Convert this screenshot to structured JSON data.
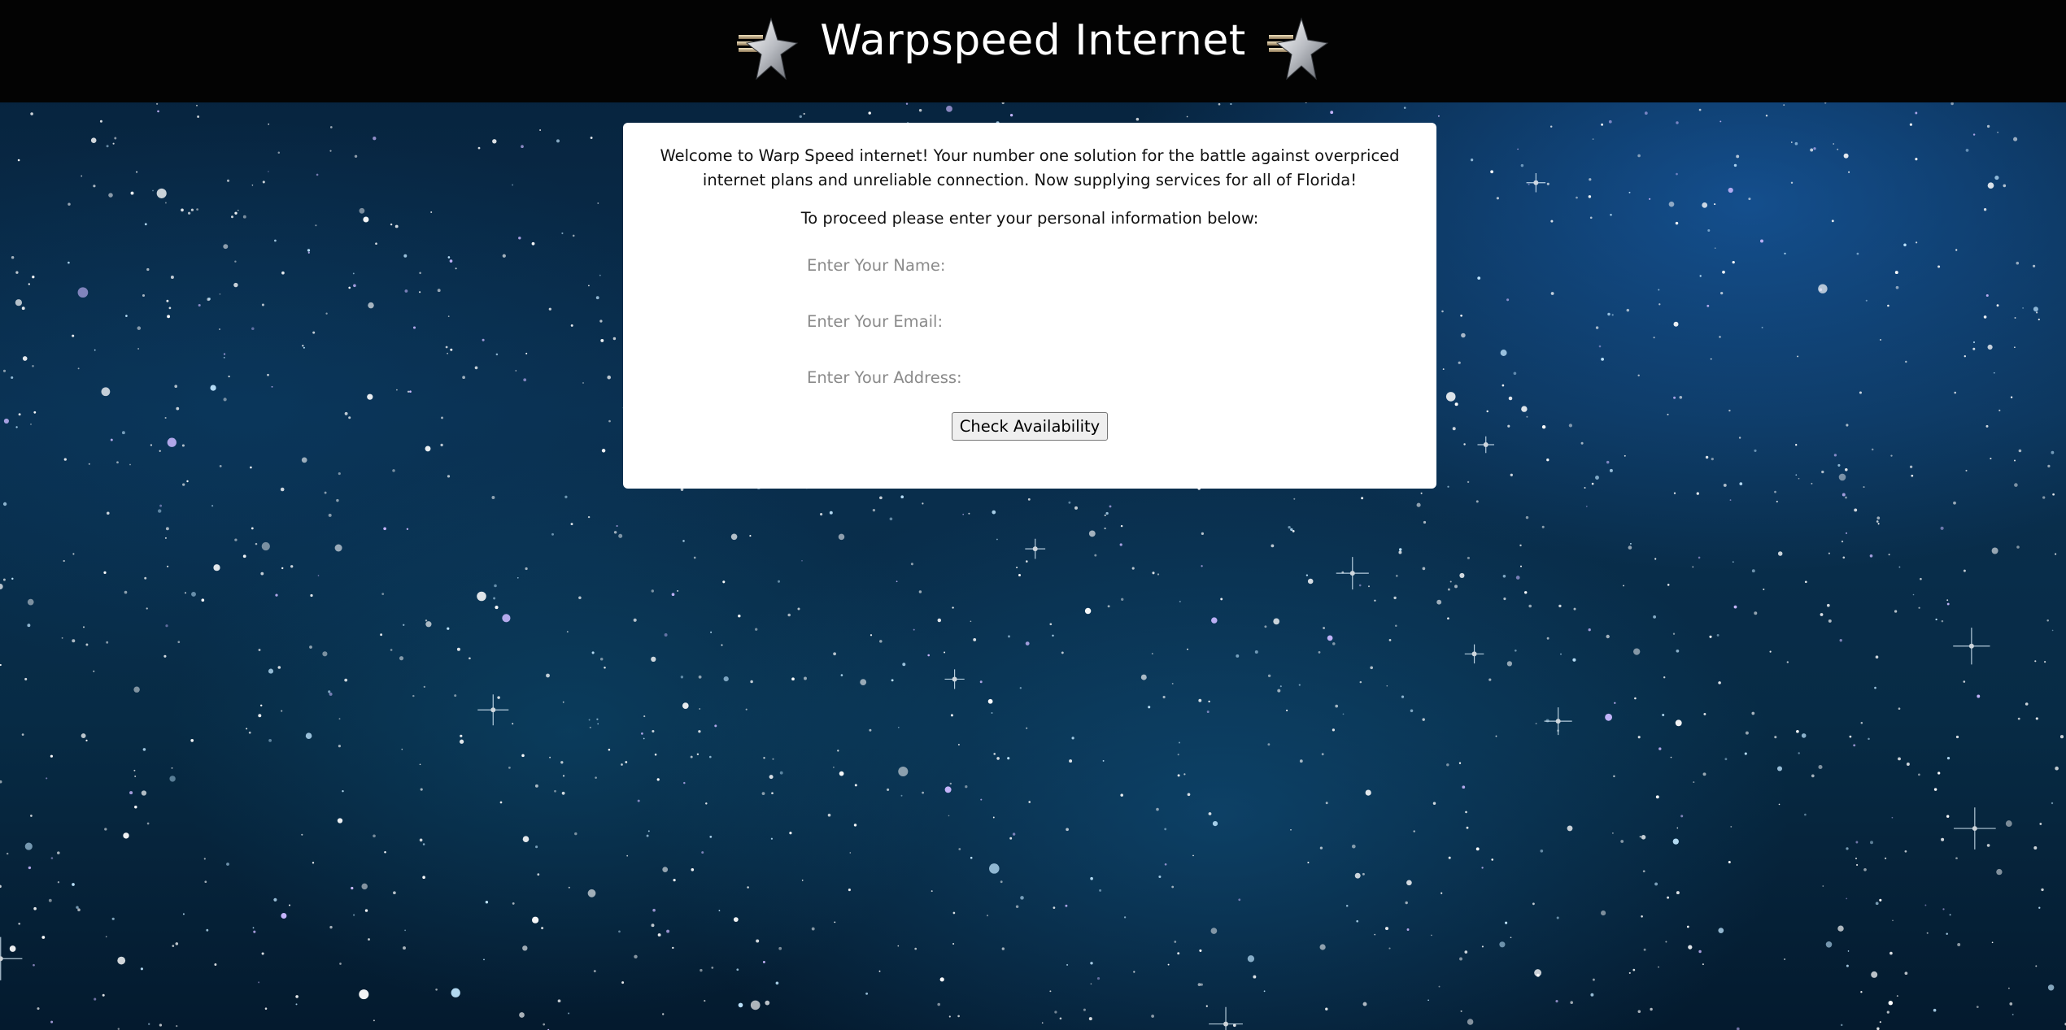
{
  "header": {
    "title": "Warpspeed Internet",
    "logo_icon": "silver-star-emblem-icon"
  },
  "card": {
    "intro": "Welcome to Warp Speed internet! Your number one solution for the battle against overpriced internet plans and unreliable connection. Now supplying services for all of Florida!",
    "prompt": "To proceed please enter your personal information below:",
    "fields": {
      "name_placeholder": "Enter Your Name:",
      "email_placeholder": "Enter Your Email:",
      "address_placeholder": "Enter Your Address:"
    },
    "submit_label": "Check Availability"
  },
  "colors": {
    "header_bg": "#030303",
    "card_bg": "#ffffff",
    "space_blue": "#0a2f4f"
  }
}
